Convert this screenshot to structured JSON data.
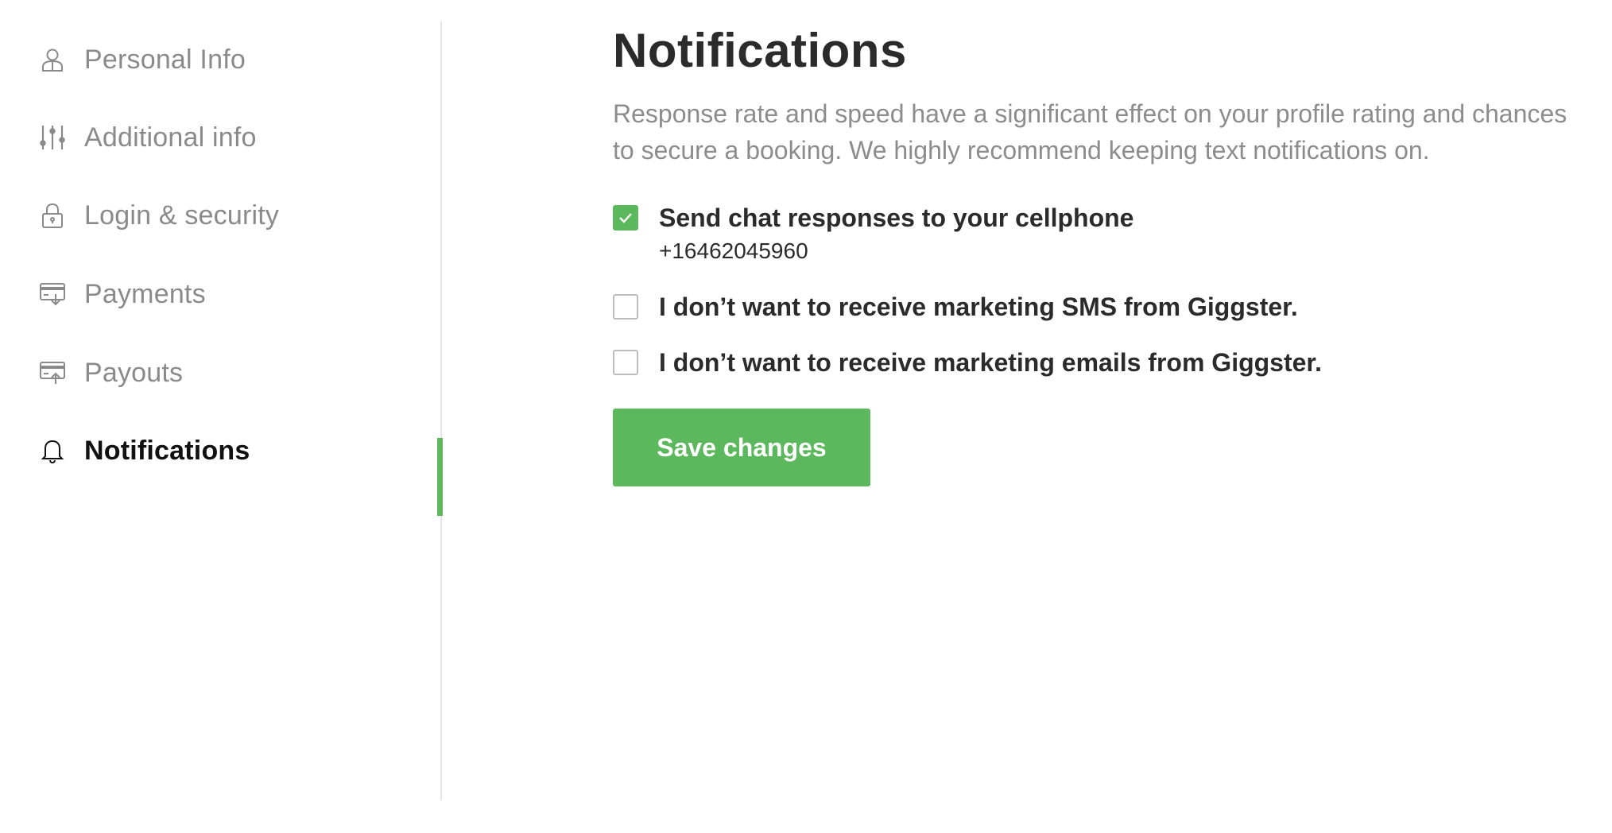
{
  "sidebar": {
    "items": [
      {
        "label": "Personal Info",
        "icon": "user-icon"
      },
      {
        "label": "Additional info",
        "icon": "sliders-icon"
      },
      {
        "label": "Login & security",
        "icon": "lock-icon"
      },
      {
        "label": "Payments",
        "icon": "card-in-icon"
      },
      {
        "label": "Payouts",
        "icon": "card-out-icon"
      },
      {
        "label": "Notifications",
        "icon": "bell-icon",
        "active": true
      }
    ]
  },
  "main": {
    "title": "Notifications",
    "description": "Response rate and speed have a significant effect on your profile rating and chances to secure a booking. We highly recommend keeping text notifications on.",
    "options": [
      {
        "label": "Send chat responses to your cellphone",
        "sub": "+16462045960",
        "checked": true
      },
      {
        "label": "I don’t want to receive marketing SMS from Giggster.",
        "checked": false
      },
      {
        "label": "I don’t want to receive marketing emails from Giggster.",
        "checked": false
      }
    ],
    "save_label": "Save changes"
  },
  "colors": {
    "accent": "#5cb85c",
    "muted_text": "#8a8a8a",
    "heading_text": "#2b2b2b"
  }
}
